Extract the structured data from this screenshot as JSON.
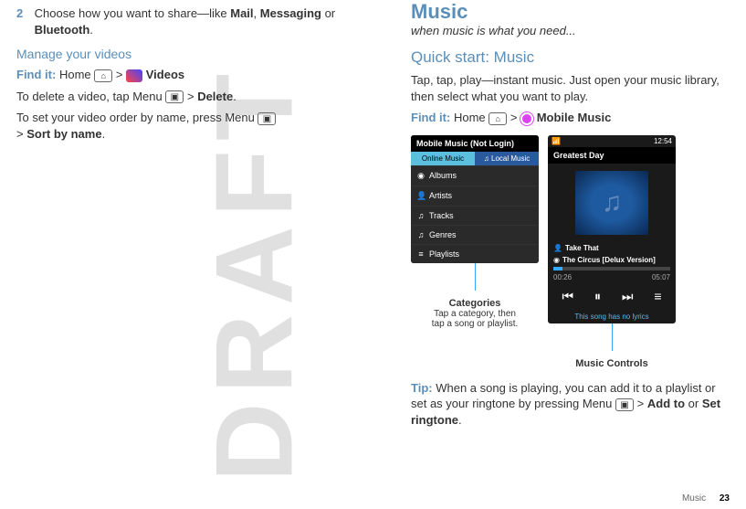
{
  "watermark": "DRAFT",
  "left": {
    "step_num": "2",
    "step_text_pre": "Choose how you want to share—like ",
    "mail": "Mail",
    "sep1": ", ",
    "messaging": "Messaging",
    "sep2": " or ",
    "bluetooth": "Bluetooth",
    "period": ".",
    "manage_title": "Manage your videos",
    "findit": "Find it:",
    "home": " Home ",
    "arrow": " > ",
    "videos_label": " Videos",
    "delete_line_pre": "To delete a video, tap Menu ",
    "delete_bold": "Delete",
    "period2": ".",
    "sort_line_pre": "To set your video order by name, press Menu ",
    "sort_bold": "Sort by name",
    "period3": ".",
    "gt2": "> "
  },
  "right": {
    "title": "Music",
    "tagline": "when music is what you need...",
    "quick": "Quick start: Music",
    "intro": "Tap, tap, play—instant music. Just open your music library, then select what you want to play.",
    "findit": "Find it:",
    "home": " Home ",
    "arrow": " > ",
    "mm": " Mobile Music",
    "phone1": {
      "header": "Mobile Music (Not Login)",
      "tab_online": "Online Music",
      "tab_local": "♫ Local Music",
      "cats": [
        "Albums",
        "Artists",
        "Tracks",
        "Genres",
        "Playlists"
      ]
    },
    "callout1_title": "Categories",
    "callout1_sub1": "Tap a category, then",
    "callout1_sub2": "tap a song or playlist.",
    "phone2": {
      "time": "12:54",
      "greatest": "Greatest Day",
      "artist": "Take That",
      "album": "The Circus [Delux Version]",
      "t_left": "00:26",
      "t_right": "05:07",
      "lyrics": "This song has no lyrics"
    },
    "callout2": "Music Controls",
    "tip": "Tip:",
    "tip_text_pre": " When a song is playing, you can add it to a playlist or set as your ringtone by pressing Menu ",
    "addto": "Add to",
    "tip_or": " or ",
    "setring": "Set ringtone",
    "period": "."
  },
  "footer": {
    "section": "Music",
    "page": "23"
  }
}
